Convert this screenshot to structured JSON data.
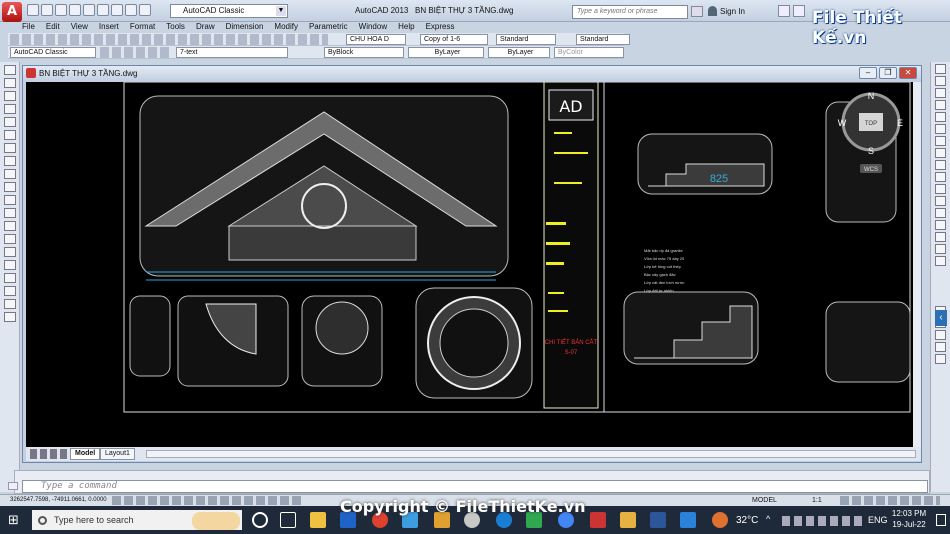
{
  "app": {
    "app_button": "A",
    "workspace": "AutoCAD Classic",
    "product": "AutoCAD 2013",
    "file": "BN BIỆT THỰ 3 TẦNG.dwg",
    "search_placeholder": "Type a keyword or phrase",
    "sign_in": "Sign In"
  },
  "menu": [
    "File",
    "Edit",
    "View",
    "Insert",
    "Format",
    "Tools",
    "Draw",
    "Dimension",
    "Modify",
    "Parametric",
    "Window",
    "Help",
    "Express"
  ],
  "toolbar1": {
    "text_style": "CHU HOA D",
    "dim_style": "Copy of 1-6",
    "table_style": "Standard",
    "multileader_style": "Standard"
  },
  "toolbar2": {
    "workspace": "AutoCAD Classic",
    "layer": "7-text",
    "color": "ByBlock",
    "linetype": "ByLayer",
    "lineweight": "ByLayer",
    "plotstyle": "ByColor"
  },
  "drawing_window": {
    "title": "BN BIỆT THỰ 3 TẦNG.dwg"
  },
  "drawing": {
    "dim_value": "825",
    "tb_logo": "AD",
    "tb_red": "CHI TIẾT BẢN CẮT",
    "tb_red2": "S-07",
    "viewcube_n": "N",
    "viewcube_s": "S",
    "viewcube_w": "W",
    "viewcube_e": "E",
    "viewcube_top": "TOP",
    "wcs": "WCS",
    "note_lines": [
      "Mặt bậc ốp đá granite",
      "Vữa lót mác 75 dày 20",
      "Lớp bê tông cốt thép",
      "Bậc xây gạch đặc",
      "Lớp cát đen tưới nước",
      "Lớp đất tự nhiên"
    ]
  },
  "layout_tabs": [
    "Model",
    "Layout1"
  ],
  "command": {
    "placeholder": "Type a command"
  },
  "status": {
    "coords": "3262547.7598, -74911.0661, 0.0000",
    "model": "MODEL",
    "scale": "1:1"
  },
  "taskbar": {
    "search_placeholder": "Type here to search",
    "temperature": "32°C",
    "lang": "ENG",
    "time": "12:03 PM",
    "date": "19-Jul-22"
  },
  "branding": {
    "logo": "File Thiết Kế.vn",
    "watermark": "Copyright © FileThietKe.vn"
  }
}
